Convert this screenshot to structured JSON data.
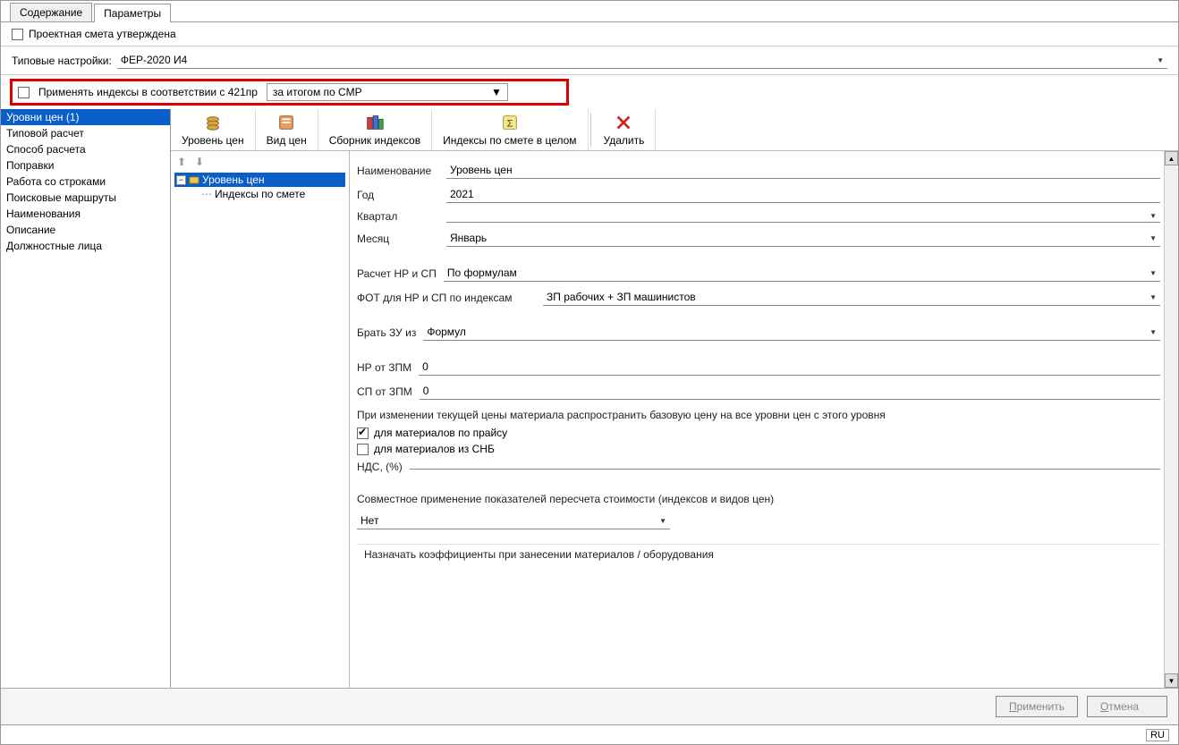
{
  "tabs": {
    "content": "Содержание",
    "params": "Параметры"
  },
  "approved_label": "Проектная смета утверждена",
  "typical_label": "Типовые настройки:",
  "typical_value": "ФЕР-2020 И4",
  "apply_index_label": "Применять индексы в соответствии с 421пр",
  "apply_index_value": "за итогом по СМР",
  "sidebar": {
    "items": [
      "Уровни цен (1)",
      "Типовой расчет",
      "Способ расчета",
      "Поправки",
      "Работа со строками",
      "Поисковые маршруты",
      "Наименования",
      "Описание",
      "Должностные лица"
    ]
  },
  "toolbar": {
    "level": "Уровень цен",
    "view": "Вид цен",
    "index_collection": "Сборник индексов",
    "index_estimate": "Индексы по смете в целом",
    "delete": "Удалить"
  },
  "tree": {
    "root": "Уровень цен",
    "child": "Индексы по смете"
  },
  "form": {
    "name_label": "Наименование",
    "name_value": "Уровень цен",
    "year_label": "Год",
    "year_value": "2021",
    "quarter_label": "Квартал",
    "quarter_value": "",
    "month_label": "Месяц",
    "month_value": "Январь",
    "nr_sp_label": "Расчет НР и СП",
    "nr_sp_value": "По формулам",
    "fot_label": "ФОТ для НР и СП по индексам",
    "fot_value": "ЗП рабочих + ЗП машинистов",
    "zu_label": "Брать ЗУ из",
    "zu_value": "Формул",
    "nr_zpm_label": "НР от ЗПМ",
    "nr_zpm_value": "0",
    "sp_zpm_label": "СП от ЗПМ",
    "sp_zpm_value": "0",
    "note": "При изменении текущей цены материала распространить базовую цену на все уровни цен с этого уровня",
    "cb1": "для материалов по прайсу",
    "cb2": "для материалов из СНБ",
    "nds_label": "НДС, (%)",
    "nds_value": "",
    "joint_label": "Совместное применение показателей пересчета стоимости (индексов и видов цен)",
    "joint_value": "Нет",
    "assign_label": "Назначать коэффициенты при занесении материалов / оборудования"
  },
  "buttons": {
    "apply": "Применить",
    "cancel": "Отмена"
  },
  "status": {
    "lang": "RU"
  }
}
